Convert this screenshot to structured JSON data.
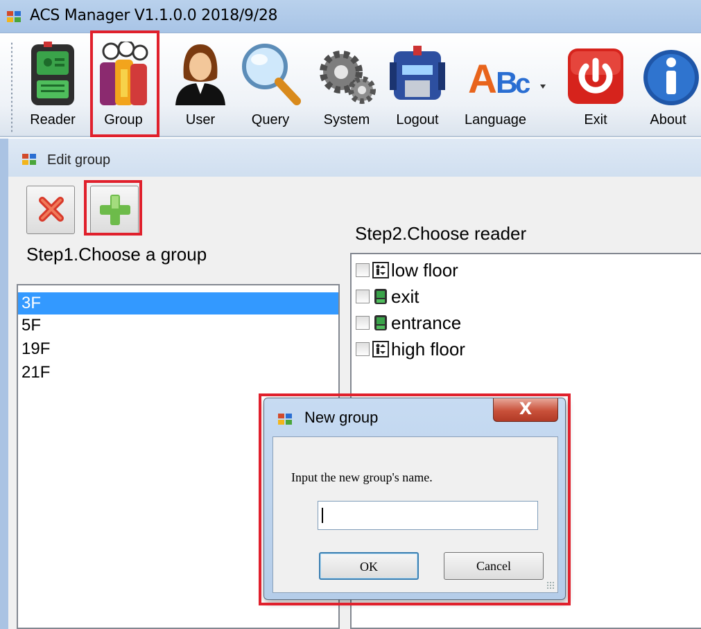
{
  "window": {
    "title": "ACS Manager V1.1.0.0  2018/9/28"
  },
  "toolbar": {
    "items": [
      {
        "label": "Reader",
        "icon": "reader-icon"
      },
      {
        "label": "Group",
        "icon": "group-icon"
      },
      {
        "label": "User",
        "icon": "user-icon"
      },
      {
        "label": "Query",
        "icon": "magnifier-icon"
      },
      {
        "label": "System",
        "icon": "gears-icon"
      },
      {
        "label": "Logout",
        "icon": "robot-icon"
      },
      {
        "label": "Language",
        "icon": "abc-icon"
      },
      {
        "label": "Exit",
        "icon": "power-icon"
      },
      {
        "label": "About",
        "icon": "info-icon"
      }
    ]
  },
  "edit_group": {
    "title": "Edit group",
    "step1": "Step1.Choose a group",
    "step2": "Step2.Choose reader",
    "groups": [
      "3F",
      "5F",
      "19F",
      "21F"
    ],
    "selected_group": "3F",
    "readers": [
      {
        "label": "low floor",
        "icon": "elevator-icon",
        "checked": false
      },
      {
        "label": "exit",
        "icon": "card-reader-icon",
        "checked": false
      },
      {
        "label": "entrance",
        "icon": "card-reader-icon",
        "checked": false
      },
      {
        "label": "high floor",
        "icon": "elevator-icon",
        "checked": false
      }
    ]
  },
  "dialog": {
    "title": "New group",
    "close": "X",
    "prompt": "Input the new group's name.",
    "input_value": "",
    "ok_label": "OK",
    "cancel_label": "Cancel"
  },
  "colors": {
    "highlight_frame": "#e0202c",
    "selection": "#3399ff",
    "titlebar": "#b9d1ec"
  }
}
